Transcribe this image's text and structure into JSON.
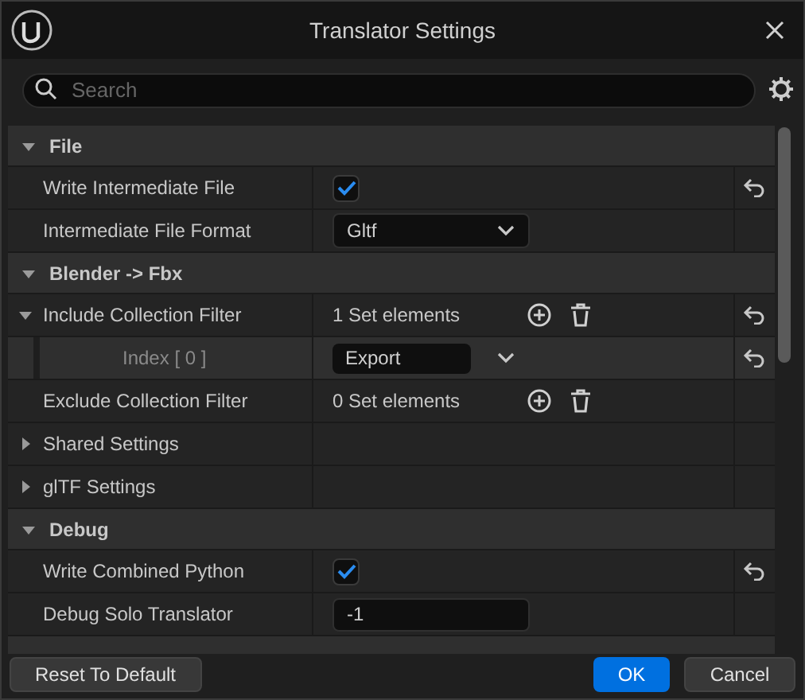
{
  "window": {
    "title": "Translator Settings"
  },
  "search": {
    "placeholder": "Search"
  },
  "sections": [
    {
      "title": "File",
      "expanded": true,
      "rows": [
        {
          "kind": "checkbox",
          "label": "Write Intermediate File",
          "checked": true,
          "reset": true
        },
        {
          "kind": "dropdown",
          "label": "Intermediate File Format",
          "value": "Gltf",
          "reset": false
        }
      ]
    },
    {
      "title": "Blender -> Fbx",
      "expanded": true,
      "rows": [
        {
          "kind": "set",
          "label": "Include Collection Filter",
          "value": "1 Set elements",
          "reset": true,
          "expanded": true,
          "children": [
            {
              "kind": "combo",
              "label": "Index [ 0 ]",
              "value": "Export",
              "reset": true
            }
          ]
        },
        {
          "kind": "set",
          "label": "Exclude Collection Filter",
          "value": "0 Set elements",
          "reset": false
        },
        {
          "kind": "group",
          "label": "Shared Settings",
          "expanded": false,
          "reset": false
        },
        {
          "kind": "group",
          "label": "glTF Settings",
          "expanded": false,
          "reset": false
        }
      ]
    },
    {
      "title": "Debug",
      "expanded": true,
      "rows": [
        {
          "kind": "checkbox",
          "label": "Write Combined Python",
          "checked": true,
          "reset": true
        },
        {
          "kind": "number",
          "label": "Debug Solo Translator",
          "value": "-1",
          "reset": false
        }
      ]
    }
  ],
  "buttons": {
    "reset": "Reset To Default",
    "ok": "OK",
    "cancel": "Cancel"
  }
}
